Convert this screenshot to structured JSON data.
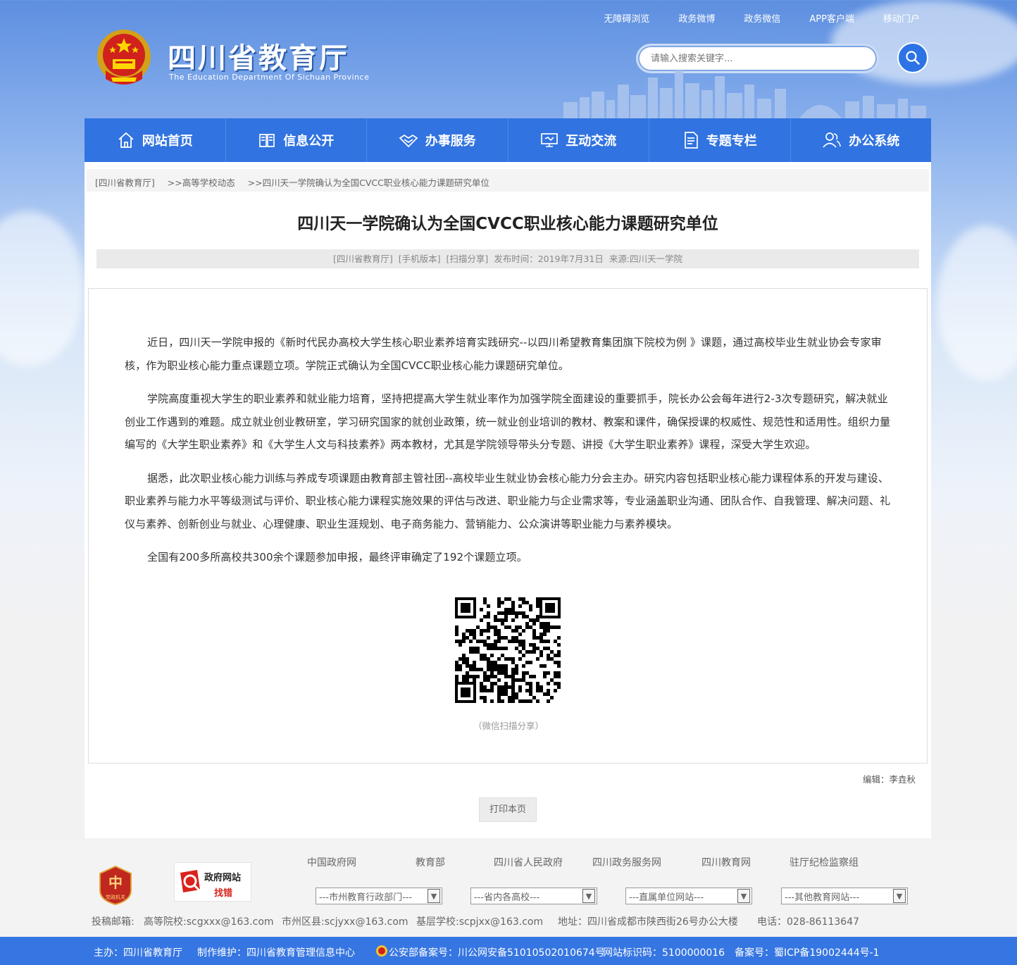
{
  "header": {
    "top_links": [
      "无障碍浏览",
      "政务微博",
      "政务微信",
      "APP客户端",
      "移动门户"
    ],
    "title": "四川省教育厅",
    "subtitle": "The Education Department Of Sichuan Province",
    "search_placeholder": "请输入搜索关键字..."
  },
  "nav": [
    {
      "label": "网站首页",
      "icon": "home-icon"
    },
    {
      "label": "信息公开",
      "icon": "book-icon"
    },
    {
      "label": "办事服务",
      "icon": "handshake-icon"
    },
    {
      "label": "互动交流",
      "icon": "monitor-icon"
    },
    {
      "label": "专题专栏",
      "icon": "document-icon"
    },
    {
      "label": "办公系统",
      "icon": "users-icon"
    }
  ],
  "breadcrumb": [
    "[四川省教育厅]",
    ">>高等学校动态",
    ">>四川天一学院确认为全国CVCC职业核心能力课题研究单位"
  ],
  "article": {
    "title": "四川天一学院确认为全国CVCC职业核心能力课题研究单位",
    "meta": {
      "source_link": "[四川省教育厅]",
      "mobile": "[手机版本]",
      "scan": "[扫描分享]",
      "publish": "发布时间：2019年7月31日",
      "origin": "来源:四川天一学院"
    },
    "paragraphs": [
      "近日，四川天一学院申报的《新时代民办高校大学生核心职业素养培育实践研究--以四川希望教育集团旗下院校为例 》课题，通过高校毕业生就业协会专家审核，作为职业核心能力重点课题立项。学院正式确认为全国CVCC职业核心能力课题研究单位。",
      "学院高度重视大学生的职业素养和就业能力培育，坚持把提高大学生就业率作为加强学院全面建设的重要抓手，院长办公会每年进行2-3次专题研究，解决就业创业工作遇到的难题。成立就业创业教研室，学习研究国家的就创业政策，统一就业创业培训的教材、教案和课件，确保授课的权威性、规范性和适用性。组织力量编写的《大学生职业素养》和《大学生人文与科技素养》两本教材，尤其是学院领导带头分专题、讲授《大学生职业素养》课程，深受大学生欢迎。",
      "据悉，此次职业核心能力训练与养成专项课题由教育部主管社团--高校毕业生就业协会核心能力分会主办。研究内容包括职业核心能力课程体系的开发与建设、职业素养与能力水平等级测试与评价、职业核心能力课程实施效果的评估与改进、职业能力与企业需求等，专业涵盖职业沟通、团队合作、自我管理、解决问题、礼仪与素养、创新创业与就业、心理健康、职业生涯规划、电子商务能力、营销能力、公众演讲等职业能力与素养模块。",
      "全国有200多所高校共300余个课题参加申报，最终评审确定了192个课题立项。"
    ],
    "qr_caption": "（微信扫描分享）",
    "editor": "编辑：李垚秋",
    "print_label": "打印本页"
  },
  "footer": {
    "links": [
      "中国政府网",
      "教育部",
      "四川省人民政府",
      "四川政务服务网",
      "四川教育网",
      "驻厅纪检监察组"
    ],
    "badge1_label": "党政机关",
    "badge2_line1": "政府网站",
    "badge2_line2": "找错",
    "selects": [
      "---市州教育行政部门---",
      "---省内各高校---",
      "---直属单位网站---",
      "---其他教育网站---"
    ],
    "contacts": [
      "投稿邮箱:",
      "高等院校:scgxxx@163.com",
      "市州区县:scjyxx@163.com",
      "基层学校:scpjxx@163.com",
      "地址：四川省成都市陕西街26号办公大楼",
      "电话：028-86113647"
    ],
    "bottom": [
      "主办：四川省教育厅",
      "制作维护：四川省教育管理信息中心",
      "公安部备案号：川公网安备51010502010674号",
      "网站标识码：5100000016",
      "备案号：蜀ICP备19002444号-1"
    ]
  }
}
